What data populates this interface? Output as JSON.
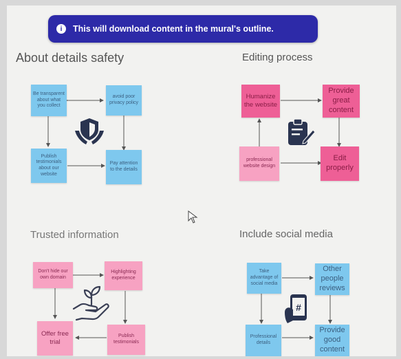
{
  "toast": {
    "message": "This will download content in the mural's outline."
  },
  "sections": {
    "safety": {
      "title": "About details safety",
      "cards": [
        "Be transparent about what you collect",
        "avoid poor privacy policy",
        "Publish testimonials about our website",
        "Pay attention to the details"
      ]
    },
    "editing": {
      "title": "Editing process",
      "cards": [
        "Humanize the website",
        "Provide great content",
        "professional website design",
        "Edit properly"
      ]
    },
    "trusted": {
      "title": "Trusted  information",
      "cards": [
        "Don't hide our own domain",
        "Highlighting experience",
        "Offer free trial",
        "Publish testimonials"
      ]
    },
    "social": {
      "title": "Include social media",
      "cards": [
        "Take advantage of social media",
        "Other people reviews",
        "Professional details",
        "Provide good content"
      ]
    }
  },
  "colors": {
    "toast": "#2d2aa8",
    "blue_note": "#7ec8ee",
    "pink_note": "#ee5f96",
    "light_pink_note": "#f7a2c2",
    "illustration": "#2a3450"
  },
  "icons": [
    "info-icon",
    "shield-hands-icon",
    "clipboard-pen-icon",
    "plant-hand-icon",
    "phone-hashtag-icon",
    "mouse-cursor-icon"
  ]
}
